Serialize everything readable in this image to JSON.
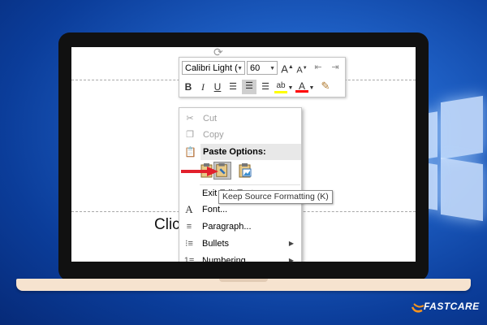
{
  "mini_toolbar": {
    "font_name": "Calibri Light (",
    "font_size": "60",
    "bold": "B",
    "italic": "I",
    "underline": "U"
  },
  "context_menu": {
    "items": [
      {
        "label": "Cut",
        "icon": "scissors-icon",
        "enabled": false
      },
      {
        "label": "Copy",
        "icon": "copy-icon",
        "enabled": false
      },
      {
        "label": "Paste Options:",
        "icon": "clipboard-icon",
        "header": true
      },
      {
        "label": "Exit Edit Text",
        "icon": ""
      },
      {
        "label": "Font...",
        "icon": "font-icon"
      },
      {
        "label": "Paragraph...",
        "icon": "paragraph-icon"
      },
      {
        "label": "Bullets",
        "icon": "bullets-icon",
        "submenu": true
      },
      {
        "label": "Numbering",
        "icon": "numbering-icon",
        "submenu": true
      }
    ]
  },
  "tooltip": "Keep Source Formatting (K)",
  "slide_text": "Clic",
  "brand": "FASTCARE",
  "colors": {
    "accent_red": "#e2202c",
    "highlight_yellow": "#ffff00",
    "font_red": "#ff0000",
    "brand_orange": "#f7941d",
    "background_blue": "#1e5fc4"
  }
}
